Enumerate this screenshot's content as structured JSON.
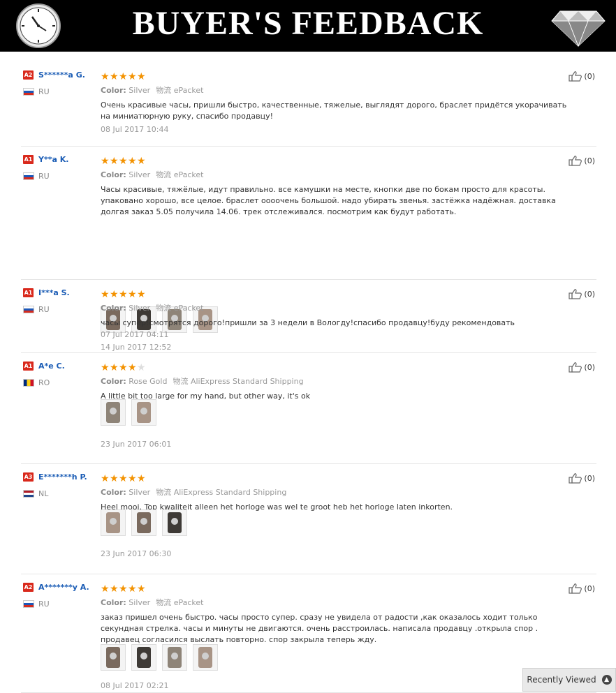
{
  "banner": {
    "title": "BUYER'S FEEDBACK"
  },
  "labels": {
    "color": "Color:",
    "shipping": "物流"
  },
  "reviews": [
    {
      "level": "A2",
      "name": "S******a G.",
      "country": "RU",
      "rating": 5,
      "color": "Silver",
      "shipping": "ePacket",
      "text": "Очень красивые часы, пришли быстро, качественные, тяжелые, выглядят дорого, браслет придётся укорачивать на миниатюрную руку, спасибо продавцу!",
      "date": "08 Jul 2017 10:44",
      "helpful": "(0)",
      "photos": 0
    },
    {
      "level": "A1",
      "name": "Y**a K.",
      "country": "RU",
      "rating": 5,
      "color": "Silver",
      "shipping": "ePacket",
      "text": "Часы красивые, тяжёлые, идут правильно. все камушки на месте, кнопки две по бокам просто для красоты. упаковано хорошо, все целое. браслет оооочень большой. надо убирать звенья. застёжка надёжная. доставка долгая заказ 5.05 получила 14.06. трек отслеживался. посмотрим как будут работать.",
      "date": "14 Jun 2017 12:52",
      "helpful": "(0)",
      "photos": 4
    },
    {
      "level": "A1",
      "name": "I***a S.",
      "country": "RU",
      "rating": 5,
      "color": "Silver",
      "shipping": "ePacket",
      "text": "часы супер!смотрятся дорого!пришли за 3 недели в Вологду!спасибо продавцу!буду рекомендовать",
      "date": "07 Jul 2017 04:11",
      "helpful": "(0)",
      "photos": 0
    },
    {
      "level": "A1",
      "name": "A*e C.",
      "country": "RO",
      "rating": 4,
      "color": "Rose Gold",
      "shipping": "AliExpress Standard Shipping",
      "text": "A little bit too large for my hand, but other way, it's ok",
      "date": "23 Jun 2017 06:01",
      "helpful": "(0)",
      "photos": 2
    },
    {
      "level": "A3",
      "name": "E*******h P.",
      "country": "NL",
      "rating": 5,
      "color": "Silver",
      "shipping": "AliExpress Standard Shipping",
      "text": "Heel mooi. Top kwaliteit alleen het horloge was wel te groot heb het horloge laten inkorten.",
      "date": "23 Jun 2017 06:30",
      "helpful": "(0)",
      "photos": 3
    },
    {
      "level": "A2",
      "name": "A*******y A.",
      "country": "RU",
      "rating": 5,
      "color": "Silver",
      "shipping": "ePacket",
      "text": "заказ пришел очень быстро. часы просто супер. сразу не увидела от радости ,как оказалось ходит только секундная стрелка. часы и минуты не двигаются. очень расстроилась. написала продавцу .открыла спор . продавец согласился выслать повторно. спор закрыла теперь жду.",
      "date": "08 Jul 2017 02:21",
      "helpful": "(0)",
      "photos": 4
    }
  ],
  "recently_viewed": {
    "label": "Recently Viewed",
    "icon": "chevron-up-icon"
  },
  "colors": {
    "accent_star": "#f39200",
    "name_link": "#1a5cb5",
    "level_badge": "#d9291c"
  }
}
